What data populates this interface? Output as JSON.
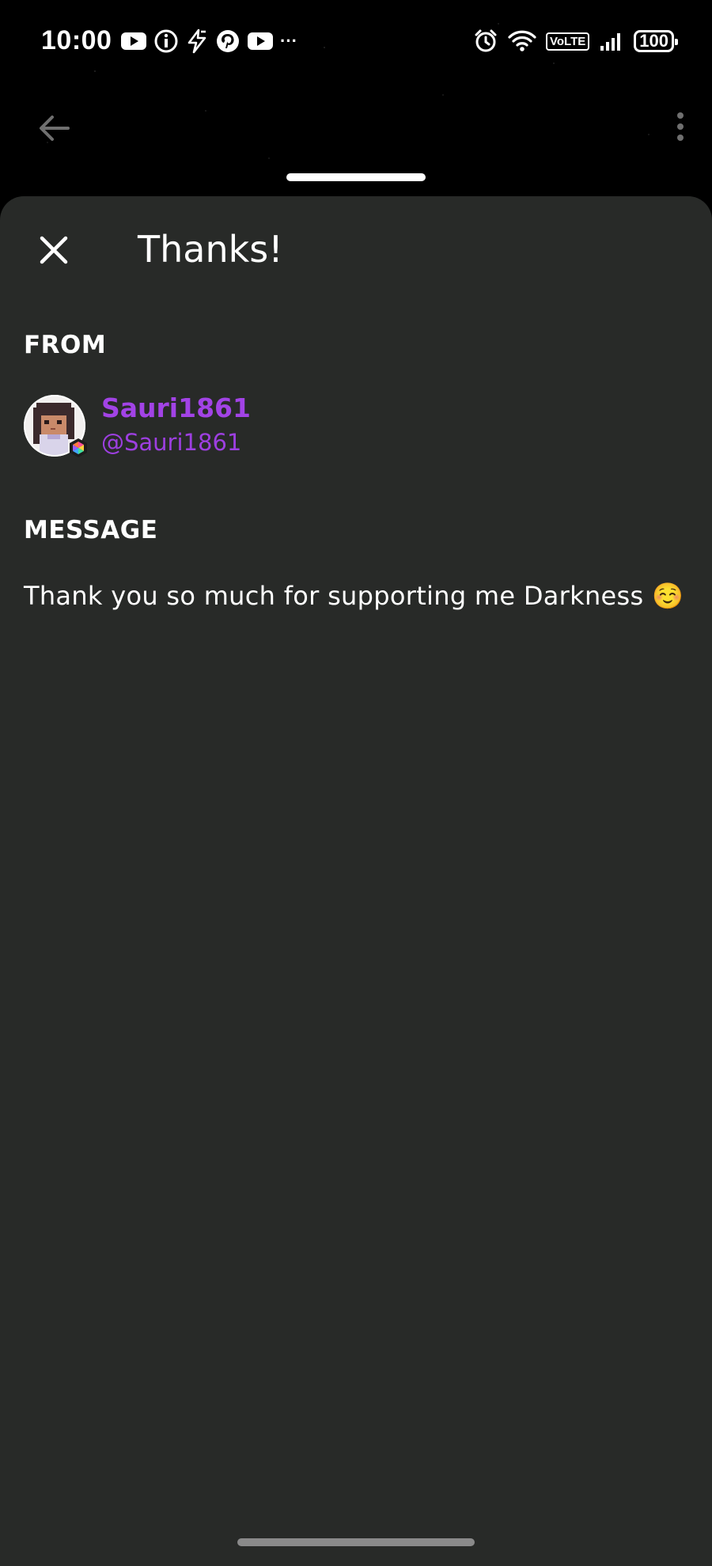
{
  "status_bar": {
    "time": "10:00",
    "left_icons": [
      "youtube-icon",
      "info-icon",
      "flash-icon",
      "pinterest-icon",
      "youtube-icon",
      "more-notifications-icon"
    ],
    "more_glyph": "···",
    "network_badge": "VoLTE",
    "battery": "100"
  },
  "app_bar": {
    "back_icon": "arrow-left-icon",
    "menu_icon": "more-vertical-icon"
  },
  "sheet": {
    "title": "Thanks!",
    "close_icon": "close-icon",
    "from_label": "FROM",
    "sender": {
      "name": "Sauri1861",
      "handle": "@Sauri1861"
    },
    "message_label": "MESSAGE",
    "message": "Thank you so much for supporting me Darkness ☺️"
  },
  "colors": {
    "sheet_background": "#282a28",
    "accent_purple": "#a243e6",
    "text_primary": "#ffffff"
  }
}
